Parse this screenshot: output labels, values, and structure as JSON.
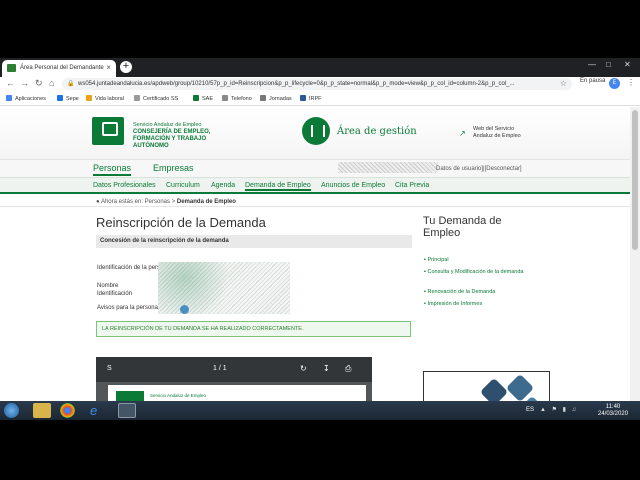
{
  "browser": {
    "tab_title": "Área Personal del Demandante",
    "tab_close": "×",
    "new_tab": "+",
    "url": "ws054.juntadeandalucia.es/apdweb/group/10210/57p_p_id=Reinscripcion&p_p_lifecycle=0&p_p_state=normal&p_p_mode=view&p_p_col_id=column-2&p_p_col_...",
    "pause_label": "En pausa",
    "profile_initial": "E",
    "bookmarks": [
      {
        "label": "Aplicaciones",
        "color": "#4285f4"
      },
      {
        "label": "Sepe",
        "color": "#1a73e8"
      },
      {
        "label": "Vida laboral",
        "color": "#e8a317"
      },
      {
        "label": "Certificado SS",
        "color": "#999999"
      },
      {
        "label": "SAE",
        "color": "#0a7a36"
      },
      {
        "label": "Telefono",
        "color": "#888888"
      },
      {
        "label": "Jornadas",
        "color": "#777777"
      },
      {
        "label": "IRPF",
        "color": "#2b5797"
      }
    ]
  },
  "header": {
    "org_line1": "Servicio Andaluz de Empleo",
    "org_line2": "CONSEJERÍA DE EMPLEO, FORMACIÓN Y TRABAJO AUTÓNOMO",
    "area_title": "Área de gestión",
    "web_link": "Web del Servicio Andaluz de Empleo"
  },
  "main_tabs": [
    "Personas",
    "Empresas"
  ],
  "user_text": "Datos de usuario]|[Desconectar]",
  "subnav": [
    "Datos Profesionales",
    "Curriculum",
    "Agenda",
    "Demanda de Empleo",
    "Anuncios de Empleo",
    "Cita Previa"
  ],
  "breadcrumb": {
    "prefix": "Ahora estás en:",
    "level1": "Personas",
    "sep": ">",
    "level2": "Demanda de Empleo"
  },
  "content": {
    "title": "Reinscripción de la Demanda",
    "section": "Concesión de la reinscripción de la demanda",
    "fields": [
      "Identificación de la persona Demandante",
      "Nombre",
      "Identificación",
      "Avisos para la persona"
    ],
    "success_msg": "LA REINSCRIPCIÓN DE TU DEMANDA SE HA REALIZADO CORRECTAMENTE."
  },
  "pdf": {
    "name": "S",
    "page": "1 / 1",
    "org": "Servicio Andaluz de Empleo"
  },
  "sidebar": {
    "title": "Tu Demanda de Empleo",
    "links": [
      "Principal",
      "Consulta y Modificación de la demanda",
      "Renovación de la Demanda",
      "Impresión de Informes"
    ]
  },
  "taskbar": {
    "lang": "ES",
    "time": "11:40",
    "date": "24/03/2020"
  }
}
